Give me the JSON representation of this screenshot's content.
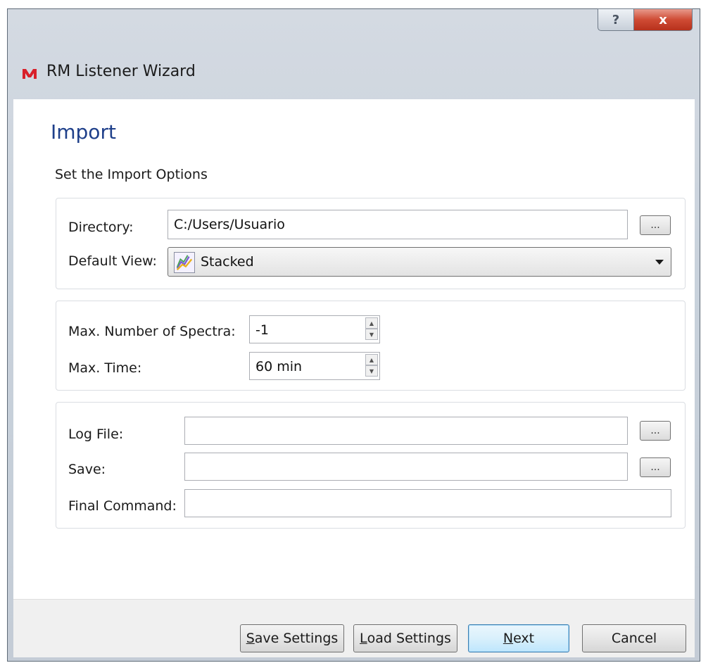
{
  "window": {
    "title": "RM Listener Wizard",
    "help_label": "?",
    "close_label": "x"
  },
  "page": {
    "title": "Import",
    "subtitle": "Set the Import Options"
  },
  "directory": {
    "label": "Directory:",
    "value": "C:/Users/Usuario",
    "browse_label": "..."
  },
  "default_view": {
    "label": "Default View:",
    "value": "Stacked",
    "icon": "stacked-view-icon"
  },
  "max_spectra": {
    "label": "Max. Number of Spectra:",
    "value": "-1"
  },
  "max_time": {
    "label": "Max. Time:",
    "value": "60 min"
  },
  "log_file": {
    "label": "Log File:",
    "value": "",
    "browse_label": "..."
  },
  "save": {
    "label": "Save:",
    "value": "",
    "browse_label": "..."
  },
  "final_command": {
    "label": "Final Command:",
    "value": ""
  },
  "footer": {
    "save_settings": {
      "mnemonic": "S",
      "rest": "ave Settings"
    },
    "load_settings": {
      "mnemonic": "L",
      "rest": "oad Settings"
    },
    "next": {
      "mnemonic": "N",
      "rest": "ext"
    },
    "cancel": "Cancel"
  },
  "colors": {
    "title_accent": "#1e3f8a",
    "close_button": "#cf4b34",
    "default_button_border": "#3c7fb1"
  }
}
